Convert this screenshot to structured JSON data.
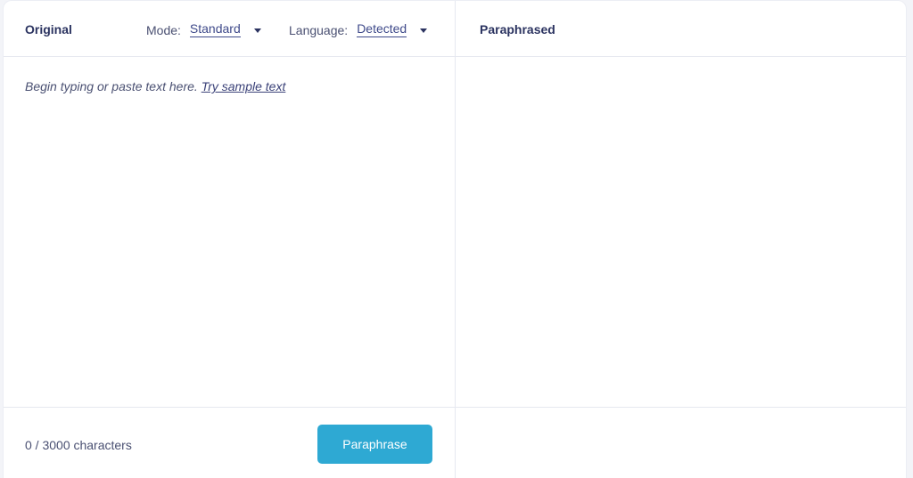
{
  "original": {
    "title": "Original",
    "mode": {
      "label": "Mode:",
      "value": "Standard"
    },
    "language": {
      "label": "Language:",
      "value": "Detected"
    },
    "placeholder": "Begin typing or paste text here.",
    "sample_link": "Try sample text",
    "char_count": "0 / 3000 characters",
    "paraphrase_button": "Paraphrase"
  },
  "paraphrased": {
    "title": "Paraphrased"
  },
  "colors": {
    "accent": "#2ea9d3",
    "title_text": "#2b3360",
    "body_text": "#4a5072"
  }
}
